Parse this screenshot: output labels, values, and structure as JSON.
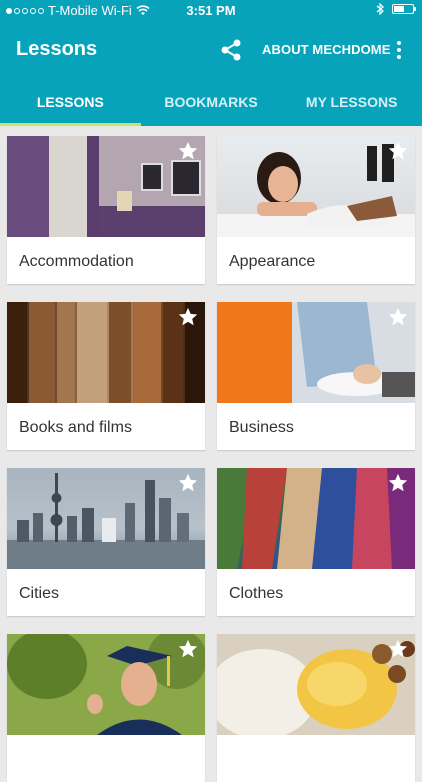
{
  "status_bar": {
    "carrier": "T-Mobile Wi-Fi",
    "time": "3:51 PM"
  },
  "app_bar": {
    "title": "Lessons",
    "about_label": "ABOUT MECHDOME",
    "accent_color": "#07a3bb",
    "tab_indicator_color": "#c7e36b"
  },
  "tabs": [
    {
      "label": "LESSONS",
      "active": true
    },
    {
      "label": "BOOKMARKS",
      "active": false
    },
    {
      "label": "MY LESSONS",
      "active": false
    }
  ],
  "lessons": [
    {
      "label": "Accommodation",
      "image": "hotel-room-image"
    },
    {
      "label": "Appearance",
      "image": "woman-portrait-image"
    },
    {
      "label": "Books and films",
      "image": "old-books-image"
    },
    {
      "label": "Business",
      "image": "man-writing-image"
    },
    {
      "label": "Cities",
      "image": "city-skyline-image"
    },
    {
      "label": "Clothes",
      "image": "neckties-image"
    },
    {
      "label": "",
      "image": "graduate-image"
    },
    {
      "label": "",
      "image": "pasta-food-image"
    }
  ]
}
